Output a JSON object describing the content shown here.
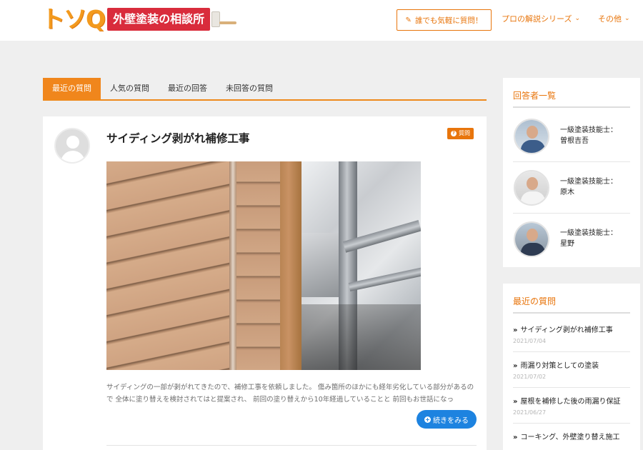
{
  "header": {
    "logo_mark": "トソQ",
    "logo_band": "外壁塗装の相談所",
    "ask_button": "誰でも気軽に質問！",
    "nav_series": "プロの解説シリーズ",
    "nav_other": "その他"
  },
  "tabs": [
    "最近の質問",
    "人気の質問",
    "最近の回答",
    "未回答の質問"
  ],
  "question": {
    "title": "サイディング剥がれ補修工事",
    "badge": "質問",
    "excerpt_line1": "サイディングの一部が剥がれてきたので、補修工事を依頼しました。 傷み箇所のほかにも経年劣化している部分があるの",
    "excerpt_line2": "で 全体に塗り替えを検討されてはと提案され、 前回の塗り替えから10年経過していることと 前回もお世話になっ",
    "more_button": "続きをみる"
  },
  "sidebar": {
    "answerers_title": "回答者一覧",
    "answerers": [
      {
        "role": "一級塗装技能士：",
        "name": "曽根吉吾"
      },
      {
        "role": "一級塗装技能士：",
        "name": "原木"
      },
      {
        "role": "一級塗装技能士：",
        "name": "星野"
      }
    ],
    "recent_title": "最近の質問",
    "recent": [
      {
        "title": "サイディング剥がれ補修工事",
        "date": "2021/07/04"
      },
      {
        "title": "雨漏り対策としての塗装",
        "date": "2021/07/02"
      },
      {
        "title": "屋根を補修した後の雨漏り保証",
        "date": "2021/06/27"
      },
      {
        "title": "コーキング、外壁塗り替え施工",
        "date": ""
      }
    ]
  },
  "colors": {
    "accent": "#e8750c",
    "tab_active": "#f0861c",
    "button_blue": "#1d83e0",
    "logo_red": "#d92c3c"
  }
}
